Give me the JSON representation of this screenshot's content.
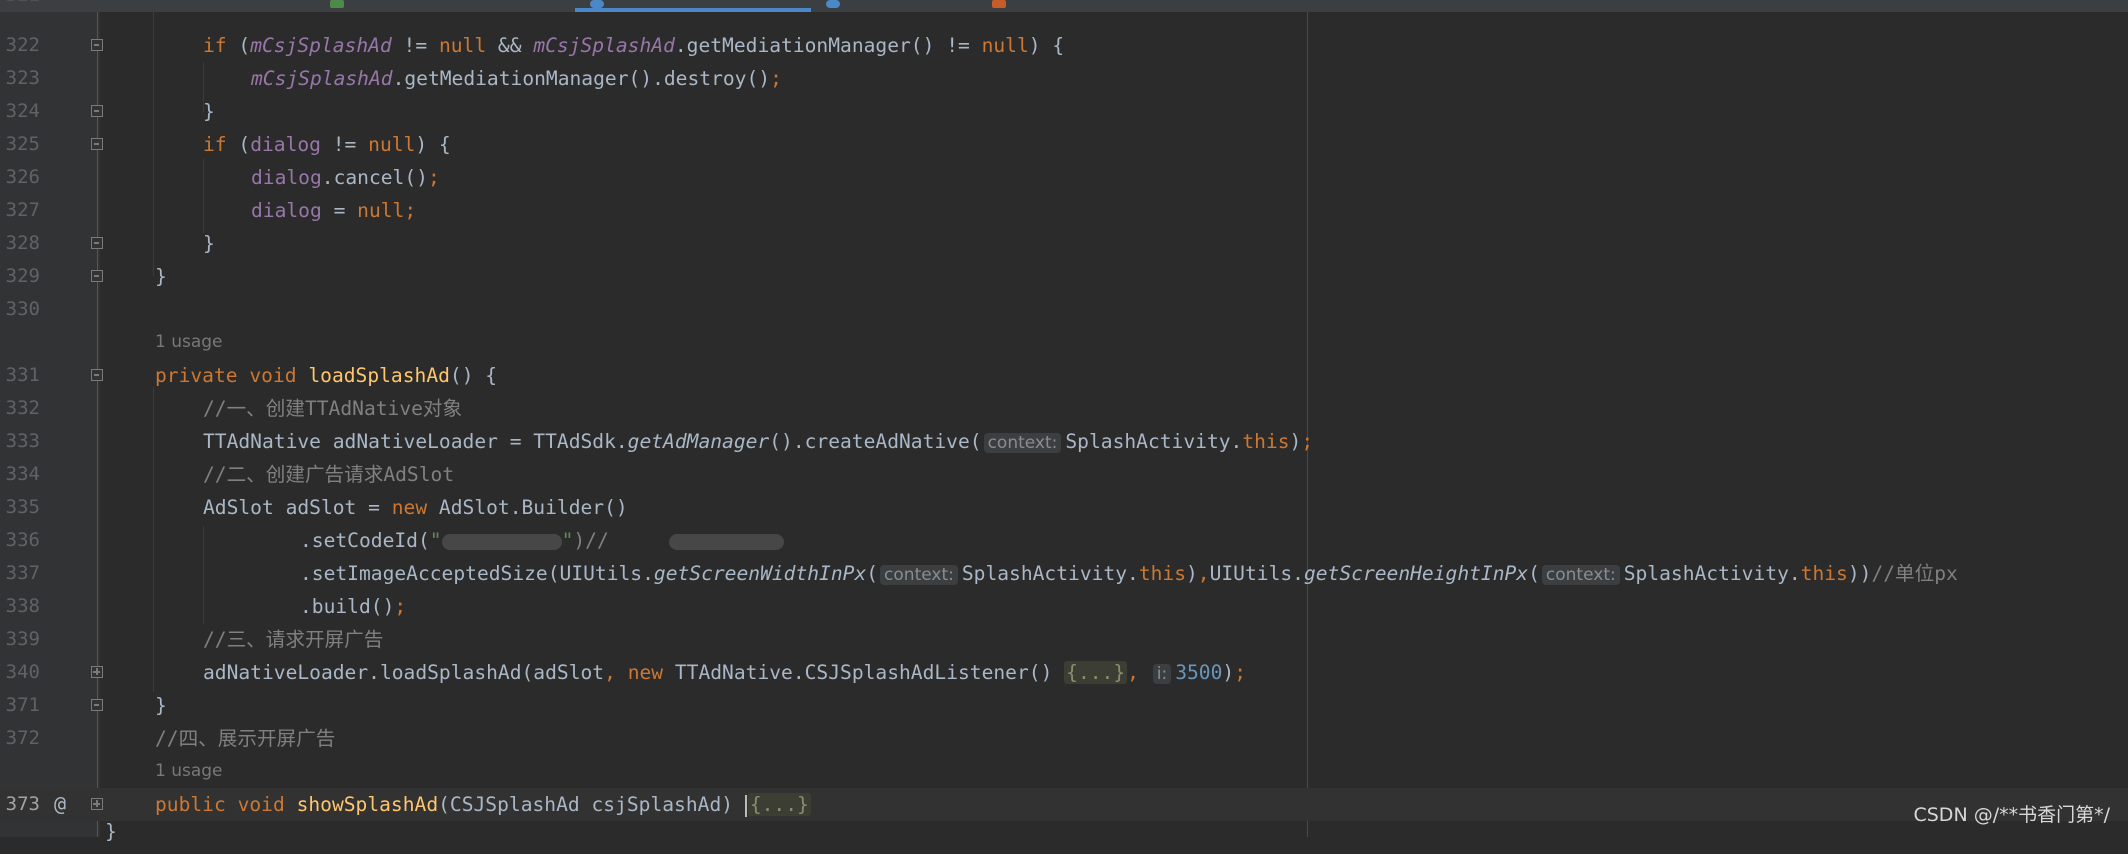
{
  "editor": {
    "usage_hint": "1 usage",
    "hint_context": "context:",
    "hint_i": "i:",
    "folded_body": "{...}",
    "gutter_at_symbol": "@",
    "line_numbers": [
      "322",
      "323",
      "324",
      "325",
      "326",
      "327",
      "328",
      "329",
      "330",
      "331",
      "332",
      "333",
      "334",
      "335",
      "336",
      "337",
      "338",
      "339",
      "340",
      "371",
      "372",
      "373"
    ]
  },
  "code": {
    "l322": {
      "if": "if",
      "paren": " (",
      "var1": "mCsjSplashAd",
      "ne1": " != ",
      "null1": "null",
      "and": " && ",
      "var2": "mCsjSplashAd",
      "call": ".getMediationManager() != ",
      "null2": "null",
      "end": ") {"
    },
    "l323": {
      "var": "mCsjSplashAd",
      "call": ".getMediationManager().destroy()",
      "semi": ";"
    },
    "l324": {
      "text": "}"
    },
    "l325": {
      "if": "if",
      "paren": " (",
      "var": "dialog",
      "ne": " != ",
      "null": "null",
      "end": ") {"
    },
    "l326": {
      "var": "dialog",
      "call": ".cancel()",
      "semi": ";"
    },
    "l327": {
      "var": "dialog",
      "eq": " = ",
      "null": "null",
      "semi": ";"
    },
    "l328": {
      "text": "}"
    },
    "l329": {
      "text": "}"
    },
    "l331": {
      "private": "private",
      "void": "void",
      "name": "loadSplashAd",
      "end": "() {"
    },
    "l332": {
      "comment": "//一、创建TTAdNative对象"
    },
    "l333": {
      "pre": "TTAdNative adNativeLoader = TTAdSdk.",
      "static_call": "getAdManager",
      "mid": "().createAdNative(",
      "arg": "SplashActivity.",
      "this": "this",
      "end": ")",
      "semi": ";"
    },
    "l334": {
      "comment": "//二、创建广告请求AdSlot"
    },
    "l335": {
      "pre": "AdSlot adSlot = ",
      "new": "new",
      "post": " AdSlot.Builder()"
    },
    "l336": {
      "pre": ".setCodeId(",
      "quote_open": "\"",
      "quote_close": "\"",
      "post": ")//"
    },
    "l337": {
      "pre": ".setImageAcceptedSize(UIUtils.",
      "static1": "getScreenWidthInPx",
      "open1": "(",
      "arg1": "SplashActivity.",
      "this1": "this",
      "close1": ")",
      "comma": ",",
      "cls2": "UIUtils.",
      "static2": "getScreenHeightInPx",
      "open2": "(",
      "arg2": "SplashActivity.",
      "this2": "this",
      "close2": "))",
      "comment": "//单位px"
    },
    "l338": {
      "call": ".build()",
      "semi": ";"
    },
    "l339": {
      "comment": "//三、请求开屏广告"
    },
    "l340": {
      "pre": "adNativeLoader.loadSplashAd(adSlot",
      "comma1": ", ",
      "new": "new",
      "cls": " TTAdNative.CSJSplashAdListener() ",
      "comma2": ", ",
      "num": "3500",
      "end": ")",
      "semi": ";"
    },
    "l371": {
      "text": "}"
    },
    "l372": {
      "comment": "//四、展示开屏广告"
    },
    "l373": {
      "public": "public",
      "void": "void",
      "name": "showSplashAd",
      "params": "(CSJSplashAd csjSplashAd) "
    }
  },
  "watermark": "CSDN @/**书香门第*/",
  "colors": {
    "background": "#2b2b2b",
    "keyword": "#cc7832",
    "field": "#9876aa",
    "method_decl": "#ffc66d",
    "number": "#6897bb",
    "comment": "#808080",
    "default_text": "#a9b7c6"
  }
}
